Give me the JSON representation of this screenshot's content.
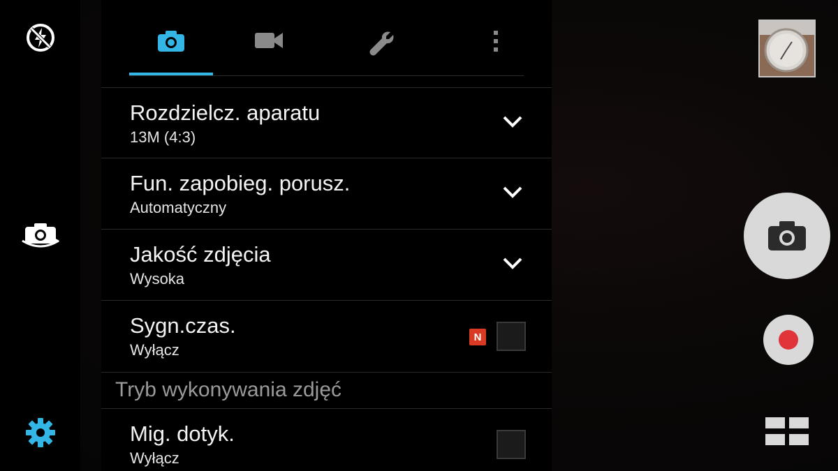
{
  "tabs": [
    {
      "name": "camera-tab",
      "icon": "camera-icon",
      "active": true
    },
    {
      "name": "video-tab",
      "icon": "video-camera-icon",
      "active": false
    },
    {
      "name": "tools-tab",
      "icon": "wrench-icon",
      "active": false
    },
    {
      "name": "more-tab",
      "icon": "more-vertical-icon",
      "active": false
    }
  ],
  "settings": [
    {
      "title": "Rozdzielcz. aparatu",
      "value": "13M (4:3)",
      "control": "dropdown"
    },
    {
      "title": "Fun. zapobieg. porusz.",
      "value": "Automatyczny",
      "control": "dropdown"
    },
    {
      "title": "Jakość zdjęcia",
      "value": "Wysoka",
      "control": "dropdown"
    },
    {
      "title": "Sygn.czas.",
      "value": "Wyłącz",
      "control": "checkbox",
      "badge": "N",
      "checked": false
    }
  ],
  "section_header": "Tryb wykonywania zdjęć",
  "settings_2": [
    {
      "title": "Mig. dotyk.",
      "value": "Wyłącz",
      "control": "checkbox",
      "checked": false
    }
  ],
  "left_rail": {
    "flash_icon": "flash-off-icon",
    "switch_camera_icon": "switch-camera-icon",
    "settings_icon": "gear-icon"
  },
  "right_rail": {
    "thumbnail": "last-photo-thumbnail",
    "shutter_icon": "camera-icon",
    "record_icon": "record-icon",
    "modes_icon": "mode-grid-icon"
  },
  "colors": {
    "accent": "#33b5e5",
    "badge": "#d83a23",
    "record": "#e0343a",
    "button_bg": "#d9d9d9"
  }
}
